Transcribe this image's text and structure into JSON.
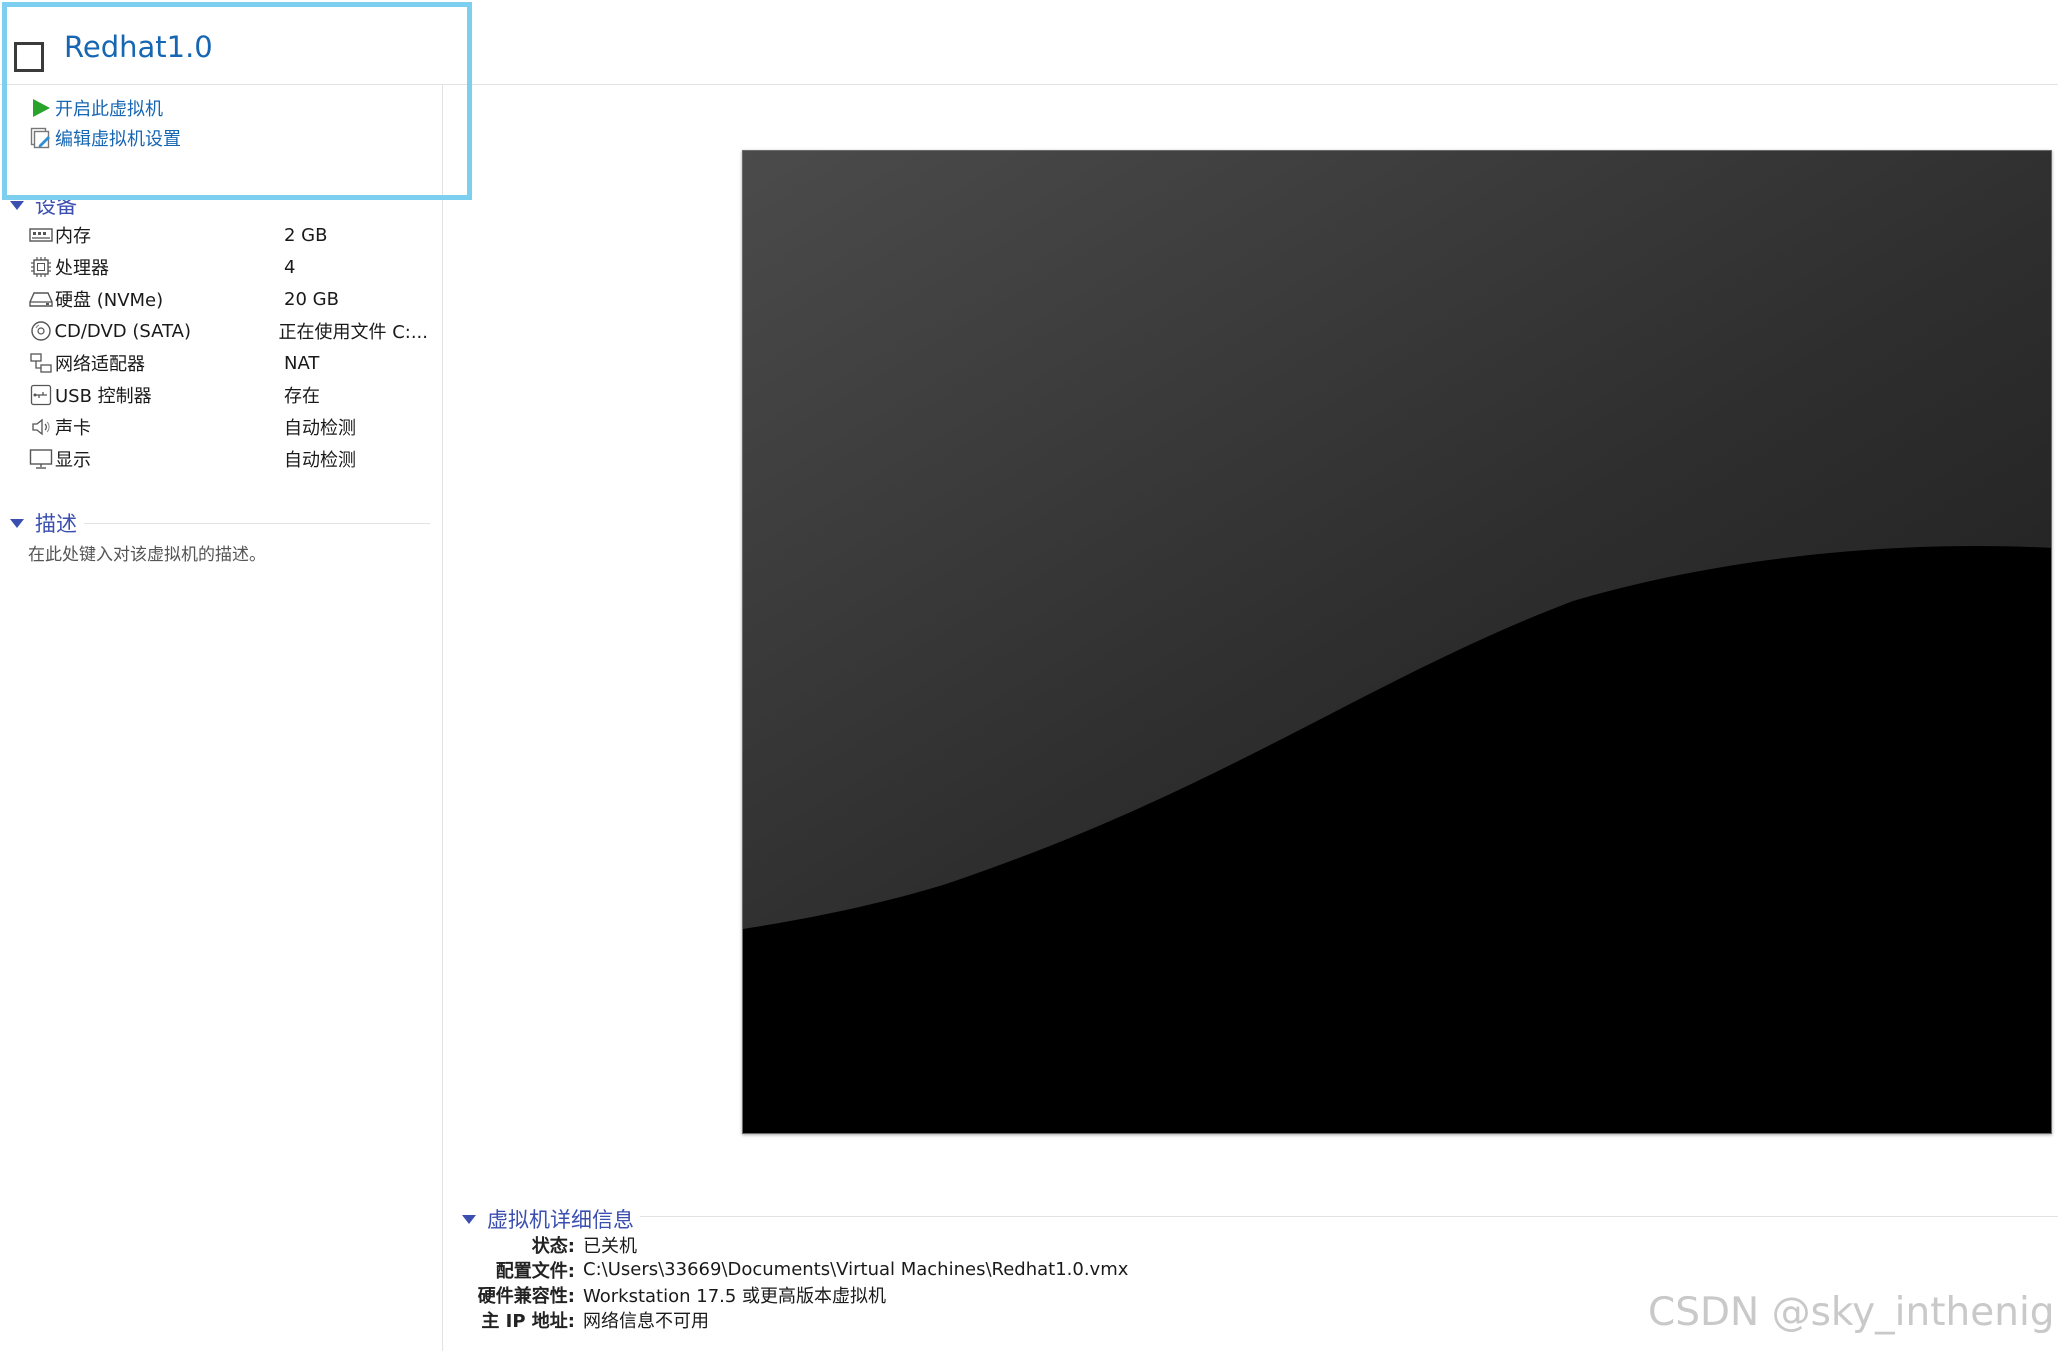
{
  "header": {
    "title": "Redhat1.0"
  },
  "actions": [
    {
      "label": "开启此虚拟机",
      "icon": "play-icon"
    },
    {
      "label": "编辑虚拟机设置",
      "icon": "edit-settings-icon"
    }
  ],
  "devices": {
    "section_label": "设备",
    "items": [
      {
        "name": "内存",
        "value": "2 GB",
        "icon": "memory-icon"
      },
      {
        "name": "处理器",
        "value": "4",
        "icon": "processor-icon"
      },
      {
        "name": "硬盘 (NVMe)",
        "value": "20 GB",
        "icon": "hard-disk-icon"
      },
      {
        "name": "CD/DVD (SATA)",
        "value": "正在使用文件 C:...",
        "icon": "cd-dvd-icon"
      },
      {
        "name": "网络适配器",
        "value": "NAT",
        "icon": "network-adapter-icon"
      },
      {
        "name": "USB 控制器",
        "value": "存在",
        "icon": "usb-icon"
      },
      {
        "name": "声卡",
        "value": "自动检测",
        "icon": "speaker-icon"
      },
      {
        "name": "显示",
        "value": "自动检测",
        "icon": "monitor-icon"
      }
    ]
  },
  "description": {
    "section_label": "描述",
    "placeholder": "在此处键入对该虚拟机的描述。"
  },
  "details": {
    "section_label": "虚拟机详细信息",
    "rows": [
      {
        "key": "状态:",
        "value": "已关机"
      },
      {
        "key": "配置文件:",
        "value": "C:\\Users\\33669\\Documents\\Virtual Machines\\Redhat1.0.vmx"
      },
      {
        "key": "硬件兼容性:",
        "value": "Workstation 17.5 或更高版本虚拟机"
      },
      {
        "key": "主 IP 地址:",
        "value": "网络信息不可用"
      }
    ]
  },
  "watermark": "CSDN @sky_inthenight",
  "colors": {
    "link": "#1766b3",
    "section_header": "#3b4fb0",
    "highlight_border": "#7ccfef",
    "play_green": "#2aa32a"
  }
}
